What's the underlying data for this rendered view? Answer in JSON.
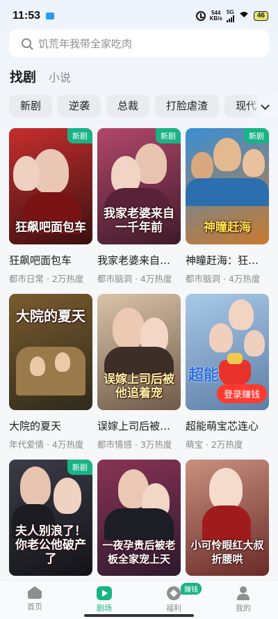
{
  "status_bar": {
    "time": "11:53",
    "net_speed_value": "544",
    "net_speed_unit": "KB/s",
    "network_type": "5G",
    "battery": "46"
  },
  "search": {
    "placeholder": "饥荒年我带全家吃肉"
  },
  "tabs": [
    {
      "label": "找剧",
      "active": true
    },
    {
      "label": "小说",
      "active": false
    }
  ],
  "filters": [
    "新剧",
    "逆袭",
    "总裁",
    "打脸虐渣",
    "现代"
  ],
  "dramas": [
    {
      "title": "狂飙吧面包车",
      "poster_text": "狂飙吧面包车",
      "meta": "都市日常 · 2万热度",
      "badge": "新剧",
      "bg1": "#c62e2e",
      "bg2": "#3a1010"
    },
    {
      "title": "我家老婆来自…",
      "poster_text": "我家老婆来自一千年前",
      "meta": "都市脑洞 · 4万热度",
      "badge": "新剧",
      "bg1": "#b2476a",
      "bg2": "#3e1b2a"
    },
    {
      "title": "神瞳赶海：狂…",
      "poster_text": "神瞳赶海",
      "meta": "都市脑洞 · 4万热度",
      "badge": "新剧",
      "bg1": "#3a8fd6",
      "bg2": "#c97a2e"
    },
    {
      "title": "大院的夏天",
      "poster_text": "大院的夏天",
      "meta": "年代爱情 · 4万热度",
      "badge": "",
      "bg1": "#7a5b2e",
      "bg2": "#2e2a1c"
    },
    {
      "title": "误嫁上司后被…",
      "poster_text": "误嫁上司后被他追着宠",
      "meta": "都市情感 · 3万热度",
      "badge": "",
      "bg1": "#d9c3a8",
      "bg2": "#6e5a48"
    },
    {
      "title": "超能萌宝芯连心",
      "poster_text": "超能",
      "meta": "萌宝 · 2万热度",
      "badge": "",
      "bg1": "#a9c9e8",
      "bg2": "#5d7fa6",
      "promo": "登录赚钱"
    },
    {
      "title": "",
      "poster_text": "夫人别浪了！你老公他破产了",
      "meta": "",
      "badge": "新剧",
      "bg1": "#3c3c48",
      "bg2": "#131318"
    },
    {
      "title": "",
      "poster_text": "一夜孕贵后被老板全家宠上天",
      "meta": "",
      "badge": "",
      "bg1": "#8a3355",
      "bg2": "#2c1a2e"
    },
    {
      "title": "",
      "poster_text": "小可怜眼红大叔折腰哄",
      "meta": "",
      "badge": "",
      "bg1": "#c99180",
      "bg2": "#6a2a26"
    }
  ],
  "bottom_nav": [
    {
      "label": "首页",
      "icon": "home-icon",
      "active": false
    },
    {
      "label": "剧场",
      "icon": "theater-icon",
      "active": true
    },
    {
      "label": "福利",
      "icon": "welfare-icon",
      "active": false,
      "badge": "赚钱"
    },
    {
      "label": "我的",
      "icon": "profile-icon",
      "active": false
    }
  ],
  "colors": {
    "accent": "#1ab385",
    "promo": "#ff3b30"
  }
}
